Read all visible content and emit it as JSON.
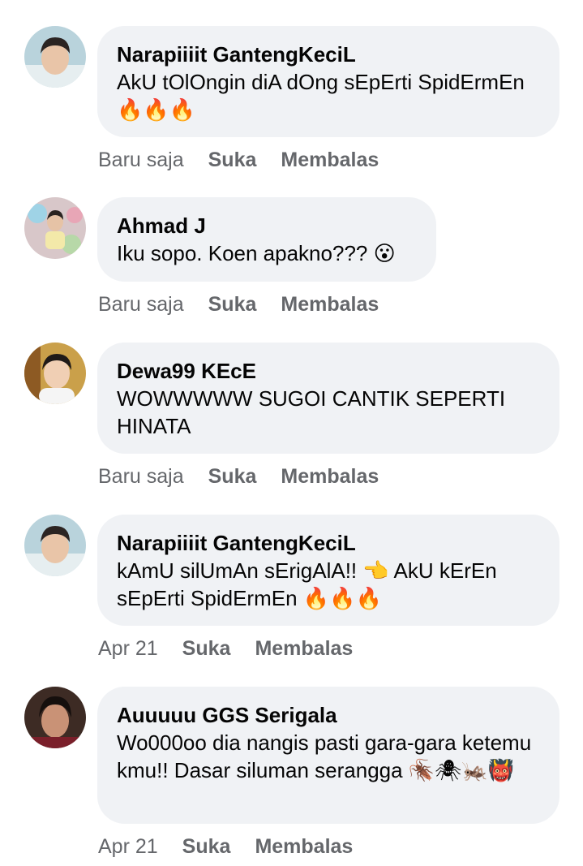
{
  "comments": [
    {
      "author": "Narapiiiit GantengKeciL",
      "text": "AkU tOlOngin diA dOng sEpErti SpidErmEn 🔥🔥🔥",
      "time": "Baru saja",
      "like": "Suka",
      "reply": "Membalas"
    },
    {
      "author": "Ahmad J",
      "text": "Iku sopo. Koen apakno??? 😮",
      "time": "Baru saja",
      "like": "Suka",
      "reply": "Membalas"
    },
    {
      "author": "Dewa99 KEcE",
      "text": "WOWWWWW SUGOI CANTIK SEPERTI HINATA",
      "time": "Baru saja",
      "like": "Suka",
      "reply": "Membalas"
    },
    {
      "author": "Narapiiiit GantengKeciL",
      "text": "kAmU silUmAn sErigAlA!! 👈 AkU kErEn sEpErti SpidErmEn 🔥🔥🔥",
      "time": "Apr 21",
      "like": "Suka",
      "reply": "Membalas"
    },
    {
      "author": "Auuuuu GGS Serigala",
      "text": "Wo000oo dia nangis pasti gara-gara ketemu kmu!! Dasar siluman serangga 🪳🕷🦗👹",
      "time": "Apr 21",
      "like": "Suka",
      "reply": "Membalas"
    }
  ],
  "colors": {
    "bubble": "#f0f2f5",
    "meta": "#65676b",
    "text": "#050505"
  }
}
